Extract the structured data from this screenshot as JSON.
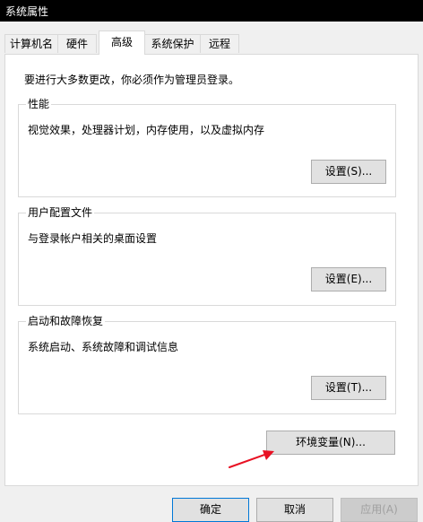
{
  "window": {
    "title": "系统属性"
  },
  "tabs": [
    {
      "label": "计算机名",
      "active": false
    },
    {
      "label": "硬件",
      "active": false
    },
    {
      "label": "高级",
      "active": true
    },
    {
      "label": "系统保护",
      "active": false
    },
    {
      "label": "远程",
      "active": false
    }
  ],
  "advanced": {
    "admin_notice": "要进行大多数更改，你必须作为管理员登录。",
    "performance": {
      "title": "性能",
      "description": "视觉效果，处理器计划，内存使用，以及虚拟内存",
      "button_label": "设置(S)..."
    },
    "user_profiles": {
      "title": "用户配置文件",
      "description": "与登录帐户相关的桌面设置",
      "button_label": "设置(E)..."
    },
    "startup_recovery": {
      "title": "启动和故障恢复",
      "description": "系统启动、系统故障和调试信息",
      "button_label": "设置(T)..."
    },
    "env_vars_button_label": "环境变量(N)..."
  },
  "footer": {
    "ok_label": "确定",
    "cancel_label": "取消",
    "apply_label": "应用(A)"
  },
  "colors": {
    "title_bar": "#000000",
    "focus_border": "#0078d7",
    "annotation_arrow": "#e81123"
  },
  "icons": {
    "annotation": "red-arrow-icon"
  }
}
